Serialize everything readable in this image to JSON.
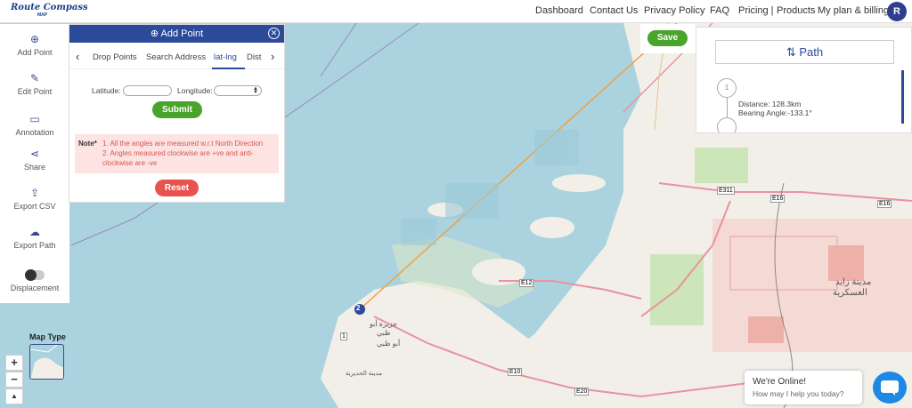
{
  "header": {
    "logo_title": "Route Compass",
    "logo_sub": "MAP",
    "nav": [
      "Dashboard",
      "Contact Us",
      "Privacy Policy",
      "FAQ",
      "Pricing |",
      "Products",
      "My plan & billing"
    ],
    "avatar_letter": "R"
  },
  "sidebar": {
    "items": [
      {
        "label": "Add Point",
        "icon": "plus-circle-icon"
      },
      {
        "label": "Edit Point",
        "icon": "pencil-icon"
      },
      {
        "label": "Annotation",
        "icon": "comment-icon"
      },
      {
        "label": "Share",
        "icon": "share-icon"
      },
      {
        "label": "Export CSV",
        "icon": "export-icon"
      },
      {
        "label": "Export Path",
        "icon": "cloud-download-icon"
      },
      {
        "label": "Displacement",
        "icon": "toggle-icon"
      }
    ]
  },
  "add_point": {
    "title": "Add Point",
    "tabs": [
      "Drop Points",
      "Search Address",
      "lat-lng",
      "Dist"
    ],
    "active_tab": "lat-lng",
    "latitude_label": "Latitude:",
    "longitude_label": "Longitude:",
    "latitude_value": "",
    "longitude_value": "",
    "submit": "Submit",
    "note_label": "Note*",
    "notes": [
      "1. All the angles are measured w.r.t North Direction",
      "2. Angles measured clockwise are +ve and anti-",
      "clockwise are -ve"
    ],
    "reset": "Reset"
  },
  "save_label": "Save",
  "path": {
    "title": "Path",
    "node_label": "1",
    "distance": "Distance: 128.3km",
    "bearing": "Bearing Angle:-133.1°"
  },
  "map": {
    "marker_label": "2",
    "labels": {
      "e311": "E311",
      "e16": "E16",
      "e16b": "E16",
      "e12": "E12",
      "e10": "E10",
      "e20": "E20",
      "r1": "1",
      "zayed_city_1": "مدينة زايد",
      "zayed_city_2": "العسكرية",
      "abu_dhabi_1": "جزيرة أبو",
      "abu_dhabi_2": "ظبي",
      "abu_dhabi_3": "أبو ظبي",
      "new_city": "مدينة الحديرية"
    },
    "map_type_label": "Map Type",
    "zoom_in": "+",
    "zoom_out": "−",
    "compass": "▲"
  },
  "chat": {
    "title": "We're Online!",
    "subtitle": "How may I help you today?"
  },
  "colors": {
    "primary": "#2c4a9a",
    "green": "#4aa32b",
    "red": "#e9534f",
    "water": "#aad3df",
    "land": "#f2efe9"
  }
}
